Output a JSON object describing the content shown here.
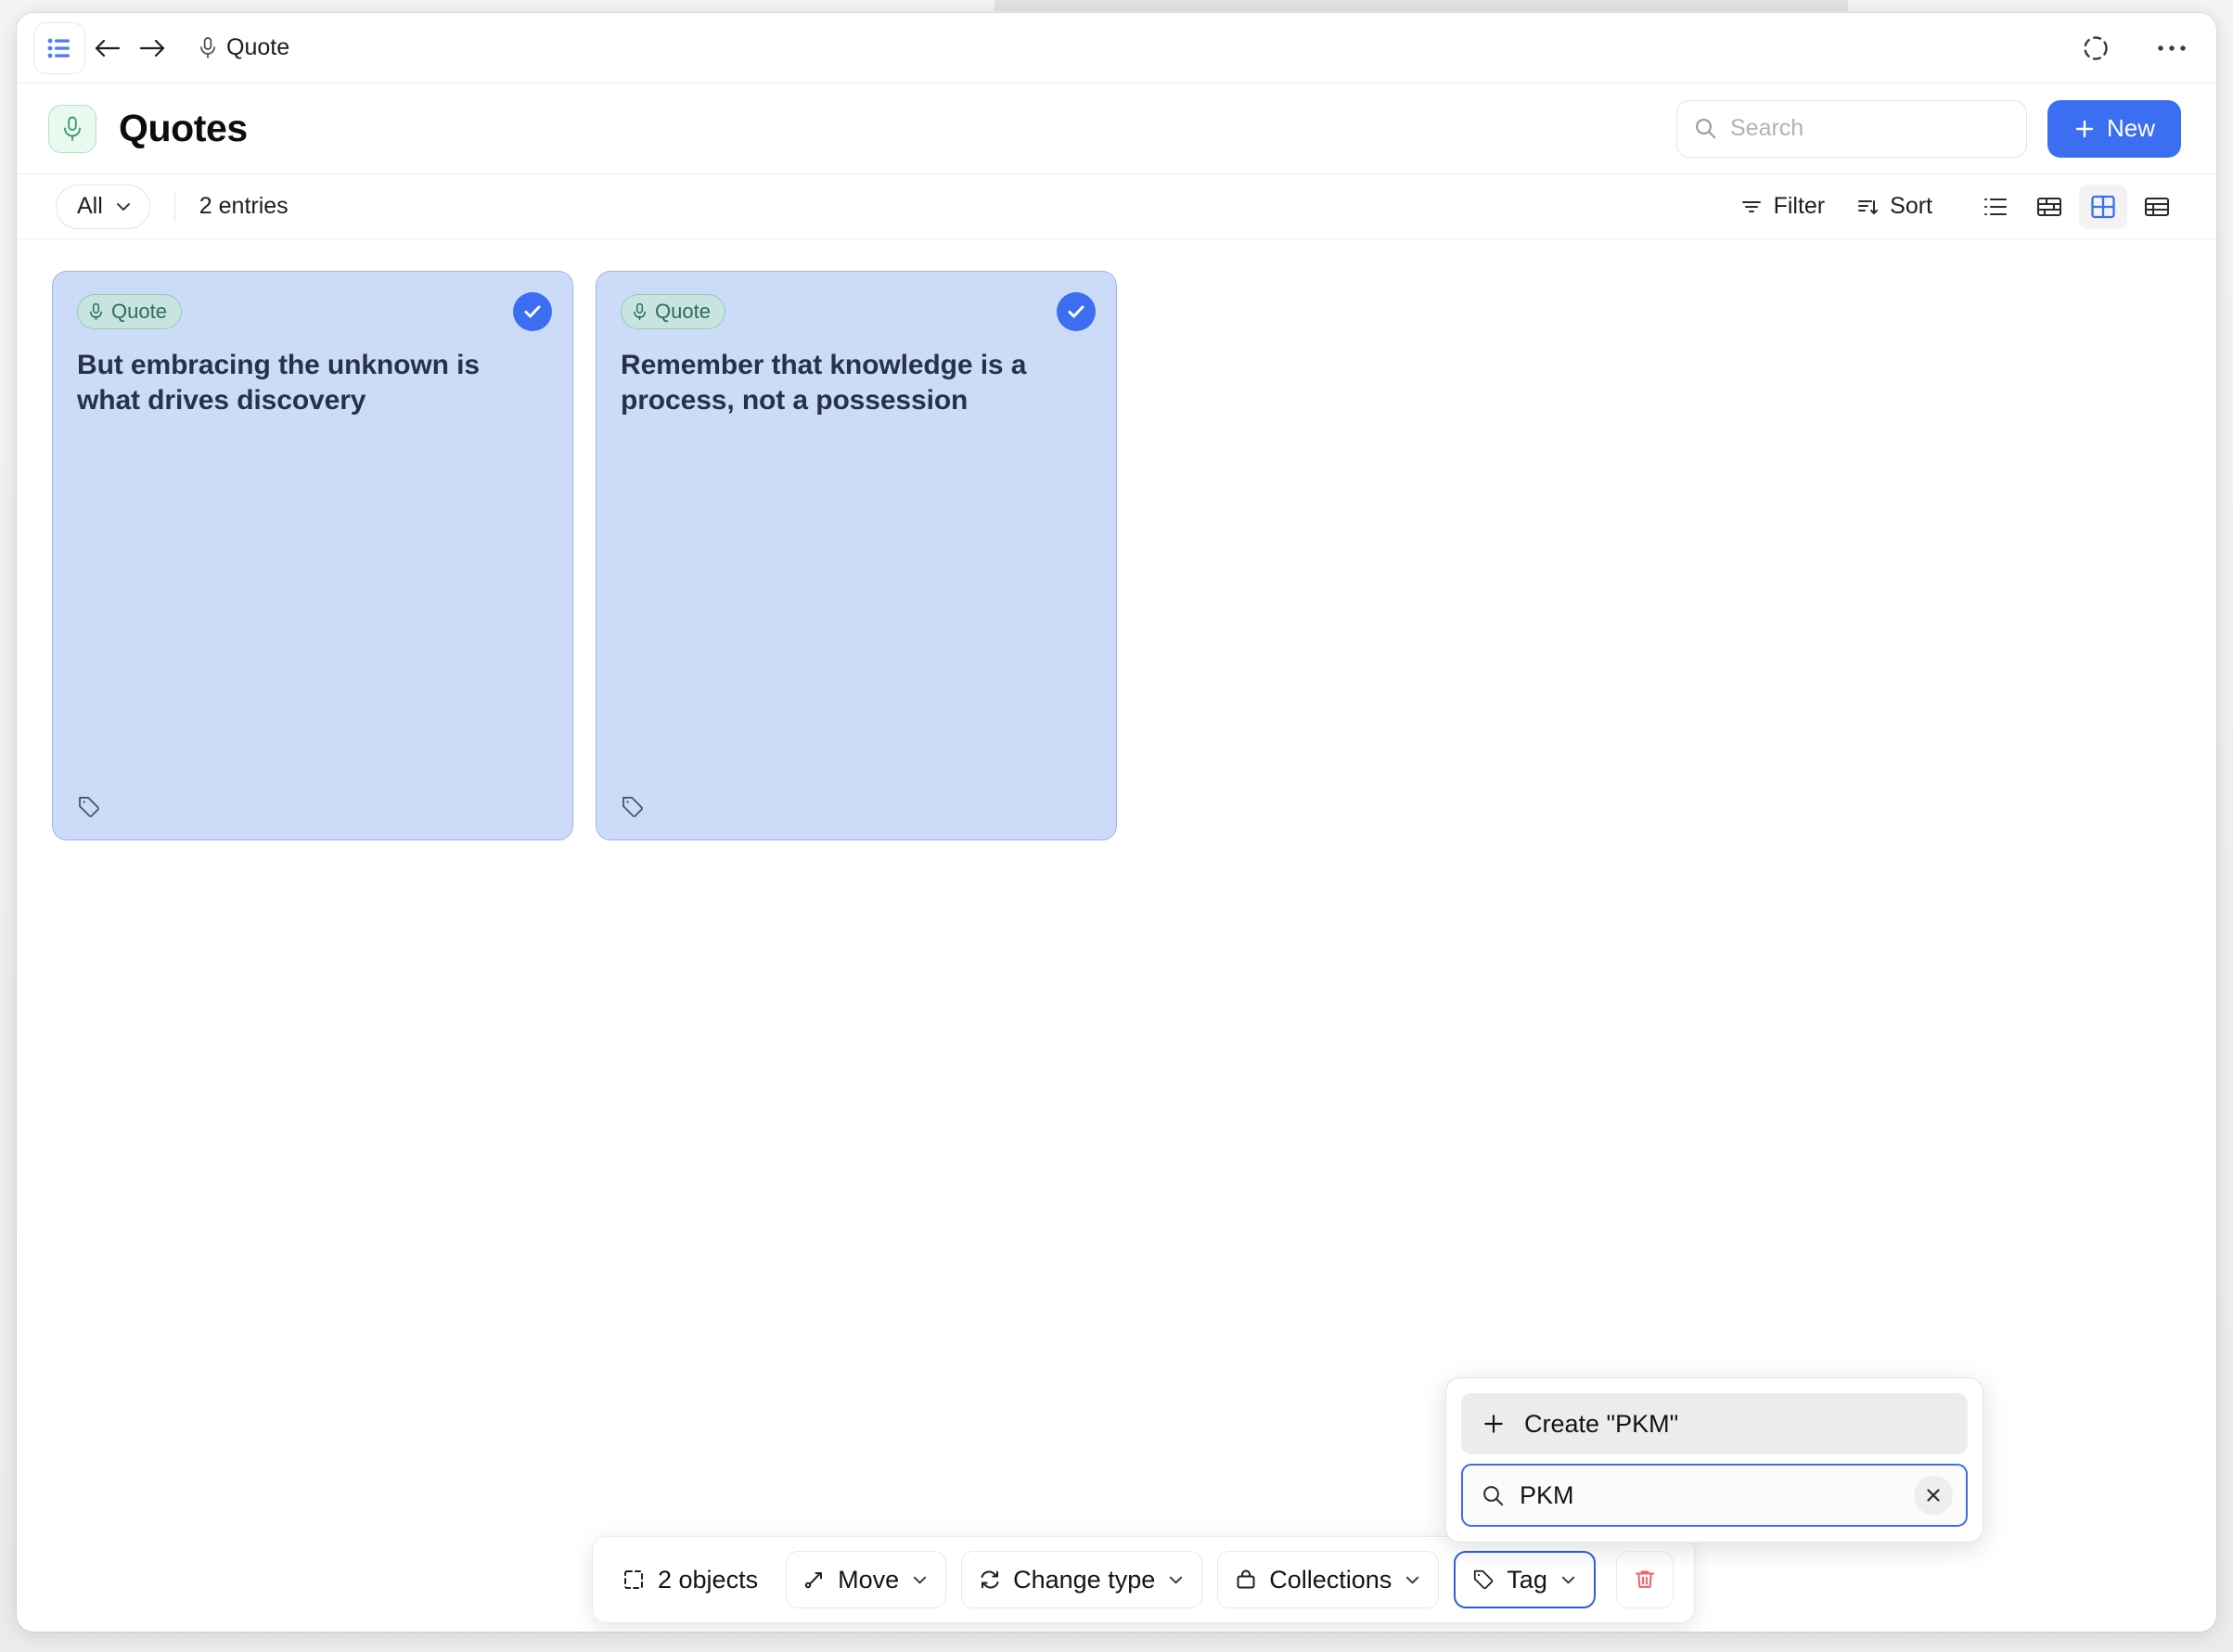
{
  "topbar": {
    "sidebar_toggle_icon": "sidebar-list-icon",
    "back_icon": "arrow-left-icon",
    "forward_icon": "arrow-right-icon",
    "breadcrumb_icon": "microphone-icon",
    "breadcrumb_label": "Quote",
    "sync_icon": "dashed-circle-icon",
    "more_icon": "ellipsis-icon"
  },
  "header": {
    "icon": "microphone-icon",
    "title": "Quotes",
    "search": {
      "placeholder": "Search",
      "value": "",
      "icon": "search-icon"
    },
    "new_button": {
      "label": "New",
      "icon": "plus-icon"
    }
  },
  "filterbar": {
    "all_label": "All",
    "all_chevron": "chevron-down-icon",
    "entries": "2 entries",
    "filter_label": "Filter",
    "filter_icon": "filter-icon",
    "sort_label": "Sort",
    "sort_icon": "sort-icon",
    "views": [
      {
        "name": "list-view",
        "icon": "list-icon",
        "active": false
      },
      {
        "name": "gallery-view",
        "icon": "brick-grid-icon",
        "active": false
      },
      {
        "name": "grid-view",
        "icon": "four-square-grid-icon",
        "active": true
      },
      {
        "name": "table-view",
        "icon": "table-icon",
        "active": false
      }
    ]
  },
  "cards": [
    {
      "badge_label": "Quote",
      "badge_icon": "microphone-icon",
      "text": "But embracing the unknown is what drives discovery",
      "selected": true,
      "tag_icon": "tag-icon"
    },
    {
      "badge_label": "Quote",
      "badge_icon": "microphone-icon",
      "text": "Remember that knowledge is a process, not a possession",
      "selected": true,
      "tag_icon": "tag-icon"
    }
  ],
  "tag_popup": {
    "create_label": "Create \"PKM\"",
    "create_icon": "plus-icon",
    "search_icon": "search-icon",
    "search_value": "PKM",
    "search_placeholder": "Search tag",
    "clear_icon": "close-icon"
  },
  "action_bar": {
    "count_label": "2 objects",
    "count_icon": "selection-icon",
    "buttons": [
      {
        "label": "Move",
        "icon": "move-arrow-icon",
        "chevron": "chevron-down-icon",
        "active": false
      },
      {
        "label": "Change type",
        "icon": "refresh-icon",
        "chevron": "chevron-down-icon",
        "active": false
      },
      {
        "label": "Collections",
        "icon": "collection-icon",
        "chevron": "chevron-down-icon",
        "active": false
      },
      {
        "label": "Tag",
        "icon": "tag-icon",
        "chevron": "chevron-down-icon",
        "active": true
      }
    ],
    "delete_icon": "trash-icon"
  },
  "colors": {
    "accent": "#3b6ef0",
    "card_bg": "#ccdcf8",
    "card_border": "#9bb6ee",
    "badge_bg": "#c9e3e0",
    "badge_text": "#2f6b62",
    "danger": "#ef6464",
    "header_icon_bg": "#e9f9ef"
  }
}
